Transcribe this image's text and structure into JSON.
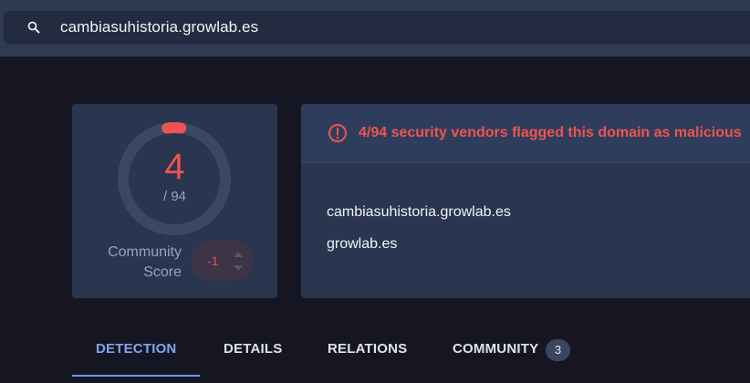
{
  "search": {
    "query": "cambiasuhistoria.growlab.es",
    "icon": "search-icon"
  },
  "score": {
    "detections": "4",
    "total": "/ 94",
    "detection_ratio": 0.0426,
    "community_label": "Community Score",
    "community_value": "-1"
  },
  "alert": {
    "text": "4/94 security vendors flagged this domain as malicious",
    "color": "#ef5350"
  },
  "domain": {
    "name": "cambiasuhistoria.growlab.es",
    "parent": "growlab.es"
  },
  "tabs": [
    {
      "label": "DETECTION",
      "active": true
    },
    {
      "label": "DETAILS"
    },
    {
      "label": "RELATIONS"
    },
    {
      "label": "COMMUNITY",
      "badge": "3"
    }
  ],
  "colors": {
    "accent": "#7ea6f0",
    "malicious": "#ef5350",
    "card": "#2a3550",
    "background": "#161622"
  }
}
